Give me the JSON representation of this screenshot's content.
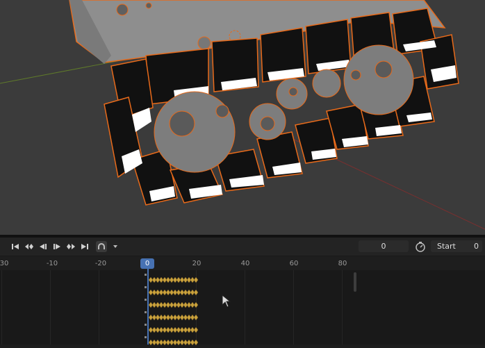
{
  "viewport": {
    "description_icon": "3d-scene-tracked-vehicle"
  },
  "transport": {
    "buttons": [
      "jump-to-start-icon",
      "prev-keyframe-icon",
      "play-reverse-icon",
      "play-icon",
      "next-keyframe-icon",
      "jump-to-end-icon",
      "auto-keying-icon",
      "keying-dropdown-icon"
    ]
  },
  "timeline": {
    "current_frame_field": "0",
    "start_label": "Start",
    "start_value": "0",
    "current_frame_marker": "0",
    "ticks": [
      "30",
      "-10",
      "-20",
      "20",
      "40",
      "60",
      "80"
    ],
    "keyframe_rows": 6
  },
  "colors": {
    "accent": "#4772b3",
    "selection_outline": "#e86a1a",
    "keyframe": "#c9a13c"
  }
}
